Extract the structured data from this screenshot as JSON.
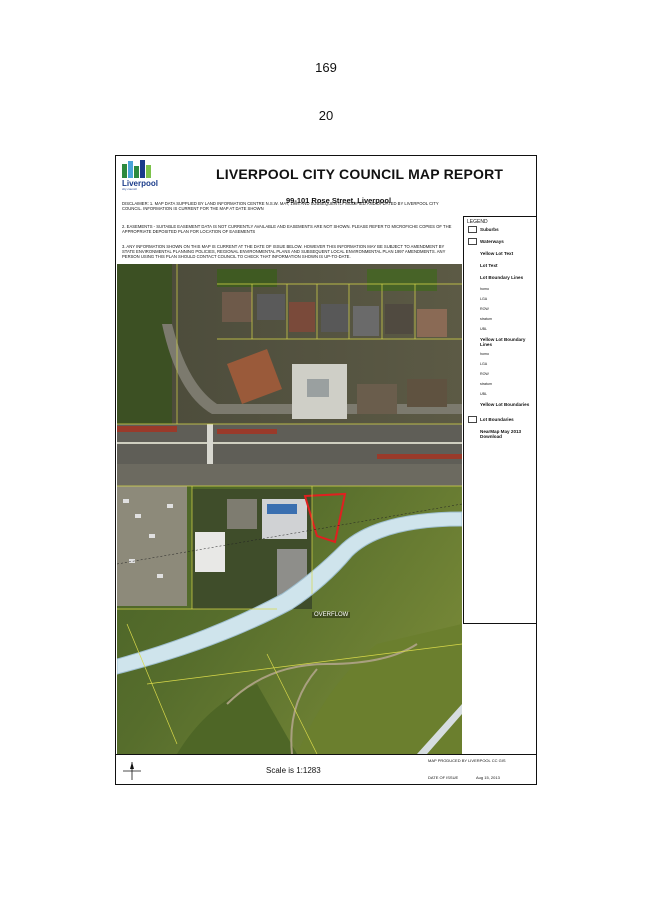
{
  "page": {
    "numbers": [
      "169",
      "20"
    ]
  },
  "report": {
    "logo_text": "Liverpool",
    "logo_sub": "city council",
    "title": "LIVERPOOL CITY COUNCIL MAP REPORT",
    "address": "99-101 Rose Street, Liverpool",
    "disclaimer": [
      "DISCLAIMER: 1. MAP DATA SUPPLIED BY LAND INFORMATION CENTRE N.S.W. MAY, 1994 AND SUBSEQUENTLY MODIFIED AND UPDATED BY LIVERPOOL CITY COUNCIL. INFORMATION IS CURRENT FOR THE MAP AT DATE SHOWN",
      "2. EASEMENTS - SUITABLE EASEMENT DATA IS NOT CURRENTLY AVAILABLE AND EASEMENTS ARE NOT SHOWN. PLEASE REFER TO MICROFICHE COPIES OF THE APPROPRIATE DEPOSITED PLAN FOR LOCATION OF EASEMENTS",
      "3. ANY INFORMATION SHOWN ON THIS MAP IS CURRENT AT THE DATE OF ISSUE BELOW. HOWEVER THIS INFORMATION MAY BE SUBJECT TO AMENDMENT BY STATE ENVIRONMENTAL PLANNING POLICIES, REGIONAL ENVIRONMENTAL PLANS AND SUBSEQUENT LOCAL ENVIRONMENTAL PLAN 1997 AMENDMENTS. ANY PERSON USING THIS PLAN SHOULD CONTACT COUNCIL TO CHECK THAT INFORMATION SHOWN IS UP-TO-DATE."
    ],
    "map_label": "OVERFLOW",
    "legend": {
      "title": "LEGEND",
      "items": [
        {
          "label": "Suburbs",
          "style": "box"
        },
        {
          "label": "Waterways",
          "style": "box"
        },
        {
          "label": "Yellow Lot Text",
          "style": "bold"
        },
        {
          "label": "Lot Text",
          "style": "bold"
        },
        {
          "label": "Lot Boundary Lines",
          "style": "bold"
        },
        {
          "label": "homo",
          "style": "small"
        },
        {
          "label": "LGA",
          "style": "small"
        },
        {
          "label": "ROW",
          "style": "small"
        },
        {
          "label": "stratum",
          "style": "small"
        },
        {
          "label": "UBL",
          "style": "small"
        },
        {
          "label": "Yellow Lot Boundary Lines",
          "style": "bold"
        },
        {
          "label": "homo",
          "style": "small"
        },
        {
          "label": "LGA",
          "style": "small"
        },
        {
          "label": "ROW",
          "style": "small"
        },
        {
          "label": "stratum",
          "style": "small"
        },
        {
          "label": "UBL",
          "style": "small"
        },
        {
          "label": "Yellow Lot Boundaries",
          "style": "bold"
        },
        {
          "label": "Lot Boundaries",
          "style": "box"
        },
        {
          "label": "NearMap May 2013 Download",
          "style": "bold"
        }
      ]
    },
    "scale": "Scale is 1:1283",
    "produced_by": "MAP PRODUCED BY LIVERPOOL CC GIS",
    "issue_label": "DATE OF ISSUE",
    "issue_date": "Aug 15, 2013"
  }
}
